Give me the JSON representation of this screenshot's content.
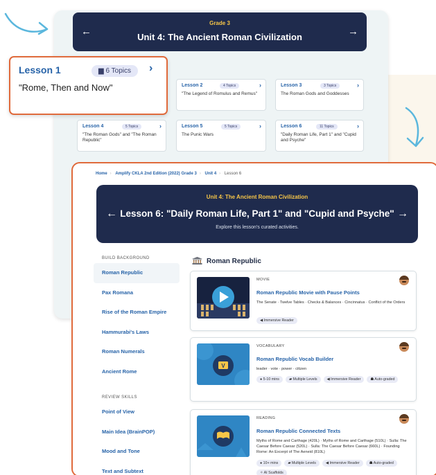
{
  "unit_page": {
    "grade": "Grade 3",
    "title": "Unit 4: The Ancient Roman Civilization",
    "prev_arrow": "←",
    "next_arrow": "→",
    "lessons": [
      {
        "label": "Lesson 1",
        "topics": "6 Topics",
        "desc": "\"Rome, Then and Now\""
      },
      {
        "label": "Lesson 2",
        "topics": "4 Topics",
        "desc": "\"The Legend of Romulus and Remus\""
      },
      {
        "label": "Lesson 3",
        "topics": "3 Topics",
        "desc": "The Roman Gods and Goddesses"
      },
      {
        "label": "Lesson 4",
        "topics": "5 Topics",
        "desc": "\"The Roman Gods\" and \"The Roman Republic\""
      },
      {
        "label": "Lesson 5",
        "topics": "5 Topics",
        "desc": "The Punic Wars"
      },
      {
        "label": "Lesson 6",
        "topics": "11 Topics",
        "desc": "\"Daily Roman Life, Part 1\" and \"Cupid and Psyche\""
      }
    ]
  },
  "breadcrumb": {
    "home": "Home",
    "program": "Amplify CKLA 2nd Edition (2022) Grade 3",
    "unit": "Unit 4",
    "current": "Lesson 6"
  },
  "lesson_banner": {
    "unit": "Unit 4: The Ancient Roman Civilization",
    "title": "Lesson 6: \"Daily Roman Life, Part 1\" and \"Cupid and Psyche\"",
    "subtitle": "Explore this lesson's curated activities.",
    "prev_arrow": "←",
    "next_arrow": "→"
  },
  "sidebar": {
    "build_heading": "BUILD BACKGROUND",
    "build_items": [
      "Roman Republic",
      "Pax Romana",
      "Rise of the Roman Empire",
      "Hammurabi's Laws",
      "Roman Numerals",
      "Ancient Rome"
    ],
    "review_heading": "REVIEW SKILLS",
    "review_items": [
      "Point of View",
      "Main Idea (BrainPOP)",
      "Mood and Tone",
      "Text and Subtext"
    ]
  },
  "section": {
    "title": "Roman Republic",
    "icon": "temple-icon"
  },
  "activities": [
    {
      "type": "MOVIE",
      "name": "Roman Republic Movie with Pause Points",
      "desc": "The Senate · Twelve Tables · Checks & Balances · Cincinnatus · Conflict of the Orders",
      "chips": [
        "◀ Immersive Reader"
      ]
    },
    {
      "type": "VOCABULARY",
      "name": "Roman Republic Vocab Builder",
      "desc": "leader · vote · power · citizen",
      "chips": [
        "● 5-10 mins",
        "▰ Multiple Levels",
        "◀ Immersive Reader",
        "☗ Auto-graded"
      ]
    },
    {
      "type": "READING",
      "name": "Roman Republic Connected Texts",
      "desc": "Myths of Rome and Carthage (420L) · Myths of Rome and Carthage (510L) · Sulla: The Caesar Before Caesar (520L) · Sulla: The Caesar Before Caesar (660L) · Founding Rome: An Excerpt of The Aeneid (810L)",
      "chips": [
        "● 10+ mins",
        "▰ Multiple Levels",
        "◀ Immersive Reader",
        "☗ Auto-graded",
        "✧ AI Scaffolds"
      ]
    }
  ],
  "colors": {
    "navy": "#1f2b4d",
    "accent_orange": "#e06a3b",
    "link_blue": "#2763a8",
    "gold": "#f7c648",
    "arrow_blue": "#5bb7dd"
  }
}
